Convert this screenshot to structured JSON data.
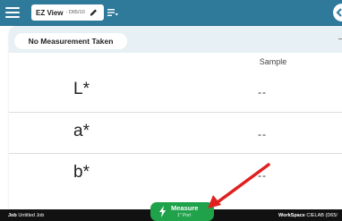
{
  "colors": {
    "topbar": "#2f7a9b",
    "header": "#e7f0f4",
    "measure": "#1fa24a",
    "annotation_arrow": "#e02020"
  },
  "icons": {
    "menu": "hamburger-icon",
    "edit": "pencil-icon",
    "view_list": "list-icon",
    "navigate": "chevron-icon",
    "measure": "lightning-bolt-icon"
  },
  "topbar": {
    "view_name": "EZ View",
    "view_sub": "- D65/10"
  },
  "card": {
    "status_chip": "No Measurement Taken",
    "column_header": "Sample",
    "rows": [
      {
        "label": "L*",
        "value": "--"
      },
      {
        "label": "a*",
        "value": "--"
      },
      {
        "label": "b*",
        "value": "--"
      }
    ]
  },
  "bottombar": {
    "job_key": "Job",
    "job_value": "Untitled Job",
    "workspace_key": "WorkSpace",
    "workspace_value": "CIELAB (D65/"
  },
  "measure": {
    "label": "Measure",
    "sub": "1\" Port"
  }
}
